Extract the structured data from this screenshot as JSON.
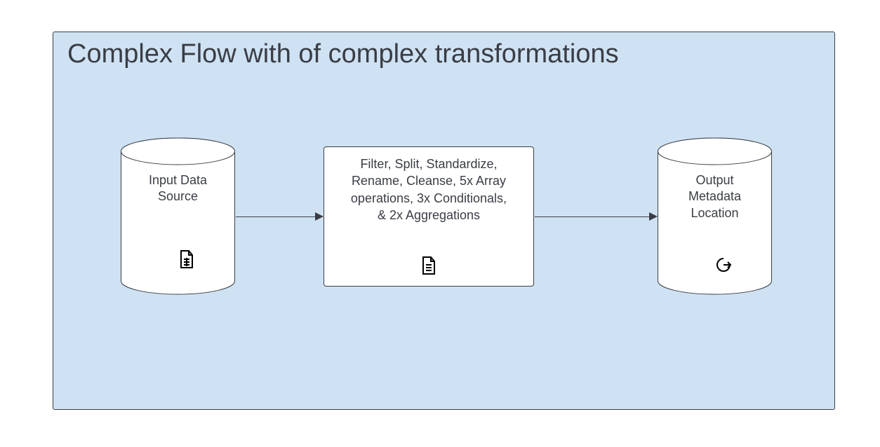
{
  "diagram": {
    "title": "Complex Flow with of complex transformations",
    "background": "#cfe2f3",
    "nodes": {
      "source": {
        "type": "cylinder",
        "label_line1": "Input Data",
        "label_line2": "Source",
        "icon": "spreadsheet-file-icon"
      },
      "transform": {
        "type": "rect",
        "label_line1": "Filter, Split, Standardize,",
        "label_line2": "Rename, Cleanse, 5x Array",
        "label_line3": "operations, 3x Conditionals,",
        "label_line4": "& 2x Aggregations",
        "icon": "document-file-icon"
      },
      "output": {
        "type": "cylinder",
        "label_line1": "Output",
        "label_line2": "Metadata",
        "label_line3": "Location",
        "icon": "export-icon"
      }
    },
    "connectors": [
      {
        "from": "source",
        "to": "transform"
      },
      {
        "from": "transform",
        "to": "output"
      }
    ]
  }
}
